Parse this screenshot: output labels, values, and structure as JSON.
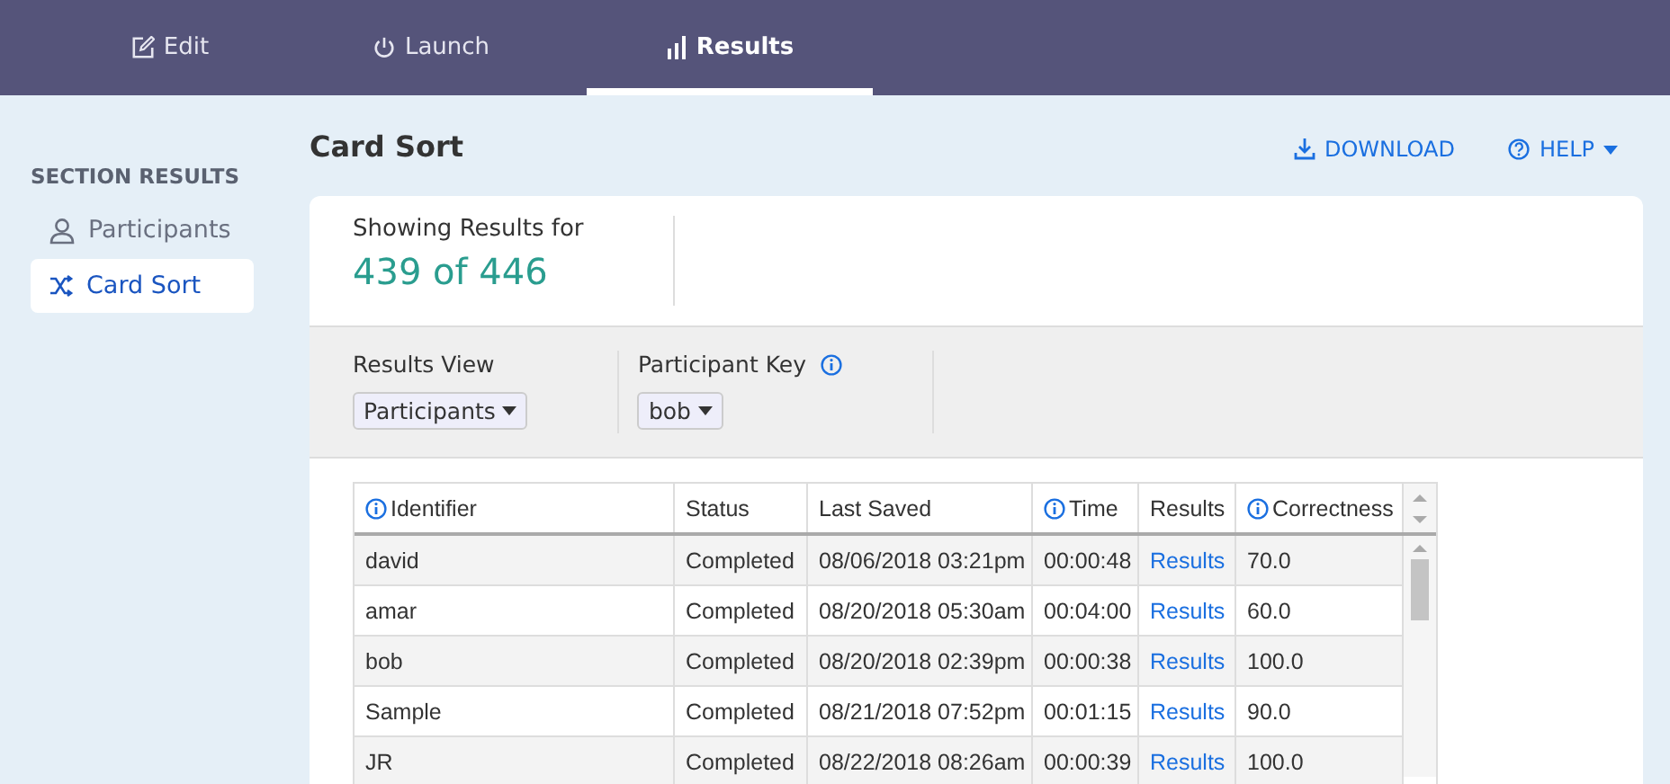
{
  "tabs": [
    {
      "label": "Edit",
      "selected": false
    },
    {
      "label": "Launch",
      "selected": false
    },
    {
      "label": "Results",
      "selected": true
    }
  ],
  "sidebar": {
    "heading": "SECTION RESULTS",
    "items": [
      {
        "label": "Participants",
        "selected": false
      },
      {
        "label": "Card Sort",
        "selected": true
      }
    ]
  },
  "page": {
    "title": "Card Sort",
    "actions": [
      {
        "label": "DOWNLOAD",
        "kind": "download"
      },
      {
        "label": "HELP",
        "kind": "menu"
      }
    ]
  },
  "summary": {
    "label": "Showing Results for",
    "value": "439 of 446"
  },
  "filters": [
    {
      "label": "Results View",
      "info": false,
      "value": "Participants"
    },
    {
      "label": "Participant Key",
      "info": true,
      "value": "bob"
    }
  ],
  "table": {
    "columns": [
      {
        "label": "Identifier",
        "info": true
      },
      {
        "label": "Status",
        "info": false
      },
      {
        "label": "Last Saved",
        "info": false
      },
      {
        "label": "Time",
        "info": true
      },
      {
        "label": "Results",
        "info": false
      },
      {
        "label": "Correctness",
        "info": true
      }
    ],
    "rows": [
      [
        "david",
        "Completed",
        "08/06/2018 03:21pm",
        "00:00:48",
        "Results",
        "70.0"
      ],
      [
        "amar",
        "Completed",
        "08/20/2018 05:30am",
        "00:04:00",
        "Results",
        "60.0"
      ],
      [
        "bob",
        "Completed",
        "08/20/2018 02:39pm",
        "00:00:38",
        "Results",
        "100.0"
      ],
      [
        "Sample",
        "Completed",
        "08/21/2018 07:52pm",
        "00:01:15",
        "Results",
        "90.0"
      ],
      [
        "JR",
        "Completed",
        "08/22/2018 08:26am",
        "00:00:39",
        "Results",
        "100.0"
      ]
    ]
  }
}
